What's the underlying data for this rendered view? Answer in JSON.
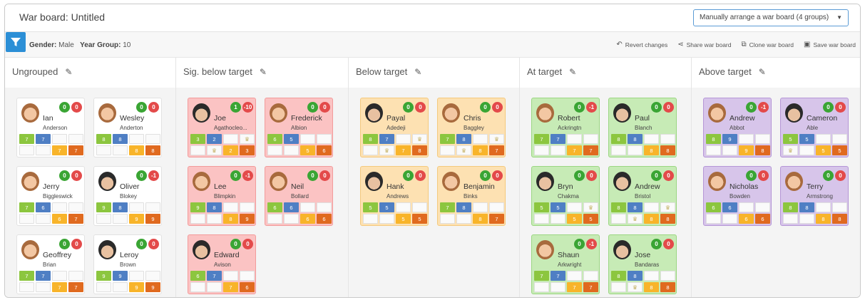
{
  "window": {
    "title": "War board: Untitled"
  },
  "arrange_select": {
    "value": "Manually arrange a war board (4 groups)"
  },
  "filter": {
    "gender_label": "Gender:",
    "gender_value": "Male",
    "year_label": "Year Group:",
    "year_value": "10"
  },
  "actions": [
    {
      "label": "Revert changes",
      "icon": "undo-icon",
      "glyph": "↶"
    },
    {
      "label": "Share war board",
      "icon": "share-icon",
      "glyph": "⋖"
    },
    {
      "label": "Clone war board",
      "icon": "clone-icon",
      "glyph": "⧉"
    },
    {
      "label": "Save war board",
      "icon": "save-icon",
      "glyph": "▣"
    }
  ],
  "colors": {
    "cell_green": "#8cc63f",
    "cell_blue": "#4f7fc4",
    "cell_yellow": "#f8b42a",
    "cell_orange": "#e06a1f",
    "badge_green": "#3aa534",
    "badge_red": "#e34a4a"
  },
  "columns": [
    {
      "title": "Ungrouped",
      "color": "white",
      "students": [
        {
          "first": "Ian",
          "last": "Anderson",
          "green": "0",
          "red": "0",
          "avatar": "brown",
          "grid": [
            "7",
            "7",
            "",
            "",
            "",
            "",
            "7",
            "7"
          ]
        },
        {
          "first": "Wesley",
          "last": "Anderton",
          "green": "0",
          "red": "0",
          "avatar": "brown",
          "grid": [
            "8",
            "8",
            "",
            "",
            "",
            "",
            "8",
            "8"
          ]
        },
        {
          "first": "Jerry",
          "last": "Biggleswick",
          "green": "0",
          "red": "0",
          "avatar": "brown",
          "grid": [
            "7",
            "6",
            "",
            "",
            "",
            "",
            "6",
            "7"
          ]
        },
        {
          "first": "Oliver",
          "last": "Blokey",
          "green": "0",
          "red": "-1",
          "avatar": "dark",
          "grid": [
            "9",
            "8",
            "",
            "",
            "",
            "",
            "9",
            "9"
          ]
        },
        {
          "first": "Geoffrey",
          "last": "Brian",
          "green": "0",
          "red": "0",
          "avatar": "brown",
          "grid": [
            "7",
            "7",
            "",
            "",
            "",
            "",
            "7",
            "7"
          ]
        },
        {
          "first": "Leroy",
          "last": "Brown",
          "green": "0",
          "red": "0",
          "avatar": "dark",
          "grid": [
            "9",
            "9",
            "",
            "",
            "",
            "",
            "9",
            "9"
          ]
        }
      ]
    },
    {
      "title": "Sig. below target",
      "color": "red",
      "students": [
        {
          "first": "Joe",
          "last": "Agathocleo...",
          "green": "1",
          "red": "-10",
          "avatar": "dark",
          "grid": [
            "3",
            "2",
            "",
            "icon",
            "",
            "icon",
            "2",
            "3"
          ]
        },
        {
          "first": "Frederick",
          "last": "Albion",
          "green": "0",
          "red": "0",
          "avatar": "brown",
          "grid": [
            "6",
            "5",
            "",
            "",
            "",
            "",
            "5",
            "6"
          ]
        },
        {
          "first": "Lee",
          "last": "Blimpkin",
          "green": "0",
          "red": "-1",
          "avatar": "brown",
          "grid": [
            "9",
            "8",
            "",
            "",
            "",
            "",
            "8",
            "9"
          ]
        },
        {
          "first": "Neil",
          "last": "Bollard",
          "green": "0",
          "red": "0",
          "avatar": "brown",
          "grid": [
            "6",
            "6",
            "",
            "",
            "",
            "",
            "6",
            "6"
          ]
        },
        {
          "first": "Edward",
          "last": "Avison",
          "green": "0",
          "red": "0",
          "avatar": "dark",
          "grid": [
            "6",
            "7",
            "",
            "",
            "",
            "",
            "7",
            "6"
          ]
        }
      ]
    },
    {
      "title": "Below target",
      "color": "yellow",
      "students": [
        {
          "first": "Payal",
          "last": "Adedeji",
          "green": "0",
          "red": "0",
          "avatar": "dark",
          "grid": [
            "8",
            "7",
            "",
            "icon",
            "",
            "icon",
            "7",
            "8"
          ]
        },
        {
          "first": "Chris",
          "last": "Baggley",
          "green": "0",
          "red": "0",
          "avatar": "brown",
          "grid": [
            "7",
            "8",
            "",
            "icon",
            "",
            "icon",
            "8",
            "7"
          ]
        },
        {
          "first": "Hank",
          "last": "Andrews",
          "green": "0",
          "red": "0",
          "avatar": "dark",
          "grid": [
            "5",
            "5",
            "",
            "",
            "",
            "",
            "5",
            "5"
          ]
        },
        {
          "first": "Benjamin",
          "last": "Binks",
          "green": "0",
          "red": "0",
          "avatar": "brown",
          "grid": [
            "7",
            "8",
            "",
            "",
            "",
            "",
            "8",
            "7"
          ]
        }
      ]
    },
    {
      "title": "At target",
      "color": "green",
      "students": [
        {
          "first": "Robert",
          "last": "Ackringtn",
          "green": "0",
          "red": "-1",
          "avatar": "brown",
          "grid": [
            "7",
            "7",
            "",
            "",
            "",
            "",
            "7",
            "7"
          ]
        },
        {
          "first": "Paul",
          "last": "Blanch",
          "green": "0",
          "red": "0",
          "avatar": "dark",
          "grid": [
            "8",
            "8",
            "",
            "",
            "",
            "",
            "8",
            "8"
          ]
        },
        {
          "first": "Bryn",
          "last": "Chakma",
          "green": "0",
          "red": "0",
          "avatar": "dark",
          "grid": [
            "5",
            "5",
            "",
            "icon",
            "",
            "",
            "5",
            "5"
          ]
        },
        {
          "first": "Andrew",
          "last": "Bristol",
          "green": "0",
          "red": "0",
          "avatar": "dark",
          "grid": [
            "8",
            "8",
            "",
            "icon",
            "",
            "icon",
            "8",
            "8"
          ]
        },
        {
          "first": "Shaun",
          "last": "Arkwright",
          "green": "0",
          "red": "-1",
          "avatar": "brown",
          "grid": [
            "7",
            "7",
            "",
            "",
            "",
            "",
            "7",
            "7"
          ]
        },
        {
          "first": "Jose",
          "last": "Bandaras",
          "green": "0",
          "red": "0",
          "avatar": "dark",
          "grid": [
            "8",
            "8",
            "",
            "",
            "",
            "icon",
            "8",
            "8"
          ]
        }
      ]
    },
    {
      "title": "Above target",
      "color": "purple",
      "students": [
        {
          "first": "Andrew",
          "last": "Abbot",
          "green": "0",
          "red": "-1",
          "avatar": "brown",
          "grid": [
            "8",
            "9",
            "",
            "",
            "",
            "",
            "9",
            "8"
          ]
        },
        {
          "first": "Cameron",
          "last": "Able",
          "green": "0",
          "red": "0",
          "avatar": "dark",
          "grid": [
            "5",
            "5",
            "",
            "",
            "icon",
            "",
            "5",
            "5"
          ]
        },
        {
          "first": "Nicholas",
          "last": "Bowden",
          "green": "0",
          "red": "0",
          "avatar": "brown",
          "grid": [
            "6",
            "6",
            "",
            "",
            "",
            "",
            "6",
            "6"
          ]
        },
        {
          "first": "Terry",
          "last": "Armstrong",
          "green": "0",
          "red": "0",
          "avatar": "brown",
          "grid": [
            "8",
            "8",
            "",
            "",
            "",
            "",
            "8",
            "8"
          ]
        }
      ]
    }
  ]
}
